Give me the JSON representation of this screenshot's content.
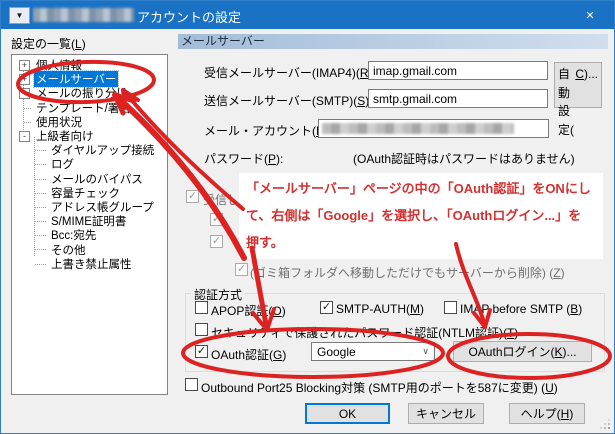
{
  "window": {
    "title": "アカウントの設定"
  },
  "icons": {
    "sysmenu": "▼",
    "close": "×",
    "check": "✓",
    "dropdown": "∨"
  },
  "colors": {
    "titlebar": "#1a72c4",
    "accent": "#0078d7",
    "annotation": "#dd2222",
    "band_from": "#a2bdd8",
    "band_to": "#d0deee"
  },
  "sidebar": {
    "label": "設定の一覧(L)",
    "tree": [
      {
        "key": "personal-info",
        "label": "個人情報",
        "exp": "+",
        "indent": 0
      },
      {
        "key": "mail-server",
        "label": "メールサーバー",
        "exp": "+",
        "indent": 0,
        "selected": true
      },
      {
        "key": "mail-filtering",
        "label": "メールの振り分け",
        "exp": "+",
        "indent": 0
      },
      {
        "key": "template-signature",
        "label": "テンプレート/署名",
        "indent": 0
      },
      {
        "key": "usage",
        "label": "使用状況",
        "indent": 0
      },
      {
        "key": "advanced",
        "label": "上級者向け",
        "exp": "-",
        "indent": 0
      },
      {
        "key": "dialup",
        "label": "ダイヤルアップ接続",
        "indent": 1
      },
      {
        "key": "log",
        "label": "ログ",
        "indent": 1
      },
      {
        "key": "mail-bypass",
        "label": "メールのバイパス",
        "indent": 1
      },
      {
        "key": "capacity-check",
        "label": "容量チェック",
        "indent": 1
      },
      {
        "key": "addressbook-group",
        "label": "アドレス帳グループ",
        "indent": 1
      },
      {
        "key": "smime-cert",
        "label": "S/MIME証明書",
        "indent": 1
      },
      {
        "key": "bcc-dest",
        "label": "Bcc:宛先",
        "indent": 1
      },
      {
        "key": "other",
        "label": "その他",
        "indent": 1
      },
      {
        "key": "overwrite-protect",
        "label": "上書き禁止属性",
        "indent": 1
      }
    ]
  },
  "main": {
    "header": "メールサーバー",
    "fields": {
      "recv_label": "受信メールサーバー(IMAP4)(R):",
      "recv_value": "imap.gmail.com",
      "send_label": "送信メールサーバー(SMTP)(S):",
      "send_value": "smtp.gmail.com",
      "auto_button": "自動設定(C)...",
      "account_label": "メール・アカウント(N):",
      "password_label": "パスワード(P):",
      "password_note": "(OAuth認証時はパスワードはありません)"
    },
    "options": {
      "leave_label": "受信した",
      "trash_label": "(ゴミ箱フォルダへ移動しただけでもサーバーから削除) (Z)"
    },
    "auth_group": {
      "title": "認証方式",
      "apop": "APOP認証(O)",
      "smtp_auth": "SMTP-AUTH(M)",
      "imap_before": "IMAP before SMTP (B)",
      "ntlm": "セキュリティで保護されたパスワード認証(NTLM認証)(T)",
      "oauth": "OAuth認証(G)",
      "provider": "Google",
      "oauth_login": "OAuthログイン(K)..."
    },
    "outbound": "Outbound Port25 Blocking対策 (SMTP用のポートを587に変更) (U)"
  },
  "state": {
    "apop": false,
    "smtp_auth": true,
    "imap_before": false,
    "ntlm": false,
    "oauth": true,
    "outbound": false,
    "leave_on_server": true,
    "sub_option1": true,
    "sub_option2": true,
    "trash_delete": true
  },
  "buttons": {
    "ok": "OK",
    "cancel": "キャンセル",
    "help": "ヘルプ(H)"
  },
  "annotation": {
    "lines": [
      "「メールサーバー」ページの中の「OAuth認証」をONにし",
      "て、右側は「Google」を選択し、「OAuthログイン...」を",
      "押す。"
    ]
  }
}
